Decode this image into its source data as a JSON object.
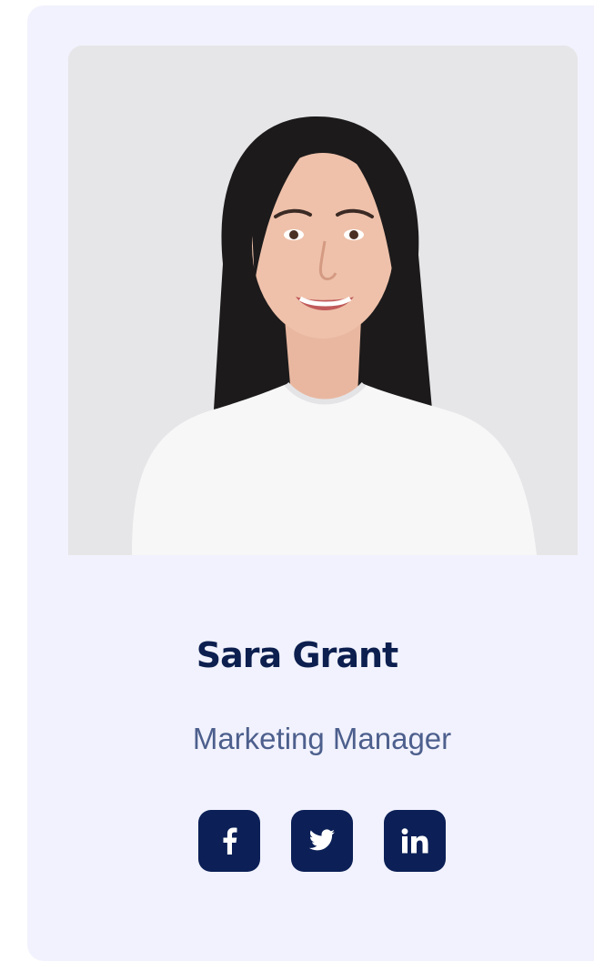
{
  "profile": {
    "name": "Sara Grant",
    "role": "Marketing Manager"
  },
  "socials": [
    {
      "icon": "facebook-icon"
    },
    {
      "icon": "twitter-icon"
    },
    {
      "icon": "linkedin-icon"
    }
  ],
  "colors": {
    "card_background": "#f1f2fd",
    "name_text": "#0d1f4f",
    "role_text": "#4d5f8d",
    "social_button": "#0c2057",
    "photo_background": "#e6e6e8"
  }
}
